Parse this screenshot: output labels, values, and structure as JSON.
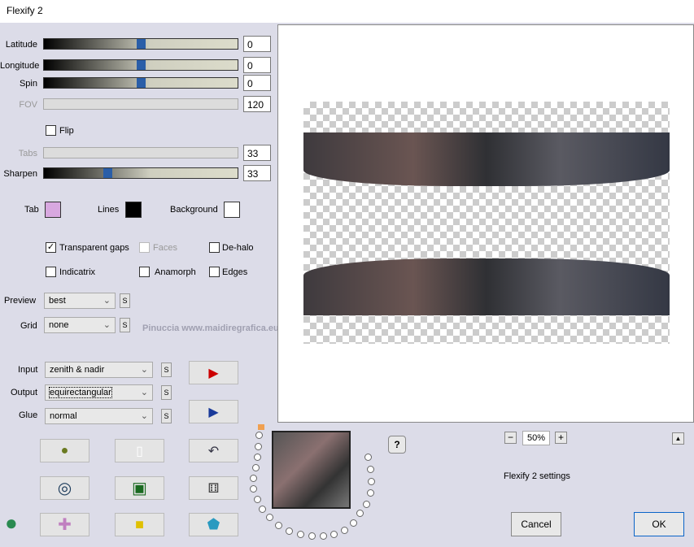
{
  "title": "Flexify 2",
  "sliders": [
    {
      "label": "Latitude",
      "value": "0",
      "pos": 0.5,
      "enabled": true
    },
    {
      "label": "Longitude",
      "value": "0",
      "pos": 0.5,
      "enabled": true
    },
    {
      "label": "Spin",
      "value": "0",
      "pos": 0.5,
      "enabled": true
    },
    {
      "label": "FOV",
      "value": "120",
      "enabled": false
    },
    {
      "label": "Tabs",
      "value": "33",
      "enabled": false
    },
    {
      "label": "Sharpen",
      "value": "33",
      "pos": 0.33,
      "enabled": true
    }
  ],
  "flip": {
    "label": "Flip",
    "checked": false
  },
  "colors": {
    "tab_label": "Tab",
    "tab": "#d8a8e0",
    "lines_label": "Lines",
    "lines": "#000000",
    "background_label": "Background",
    "background": "#ffffff"
  },
  "options": {
    "transparent_gaps": "Transparent gaps",
    "faces": "Faces",
    "de_halo": "De-halo",
    "indicatrix": "Indicatrix",
    "anamorph": "Anamorph",
    "edges": "Edges"
  },
  "preview": {
    "label": "Preview",
    "value": "best"
  },
  "grid": {
    "label": "Grid",
    "value": "none"
  },
  "input": {
    "label": "Input",
    "value": "zenith & nadir"
  },
  "output": {
    "label": "Output",
    "value": "equirectangular"
  },
  "glue": {
    "label": "Glue",
    "value": "normal"
  },
  "s": "S",
  "watermark": "Pinuccia www.maidiregrafica.eu",
  "zoom": {
    "minus": "−",
    "value": "50%",
    "plus": "+"
  },
  "help": "?",
  "up": "▲",
  "settings_name": "Flexify 2 settings",
  "cancel": "Cancel",
  "ok": "OK"
}
